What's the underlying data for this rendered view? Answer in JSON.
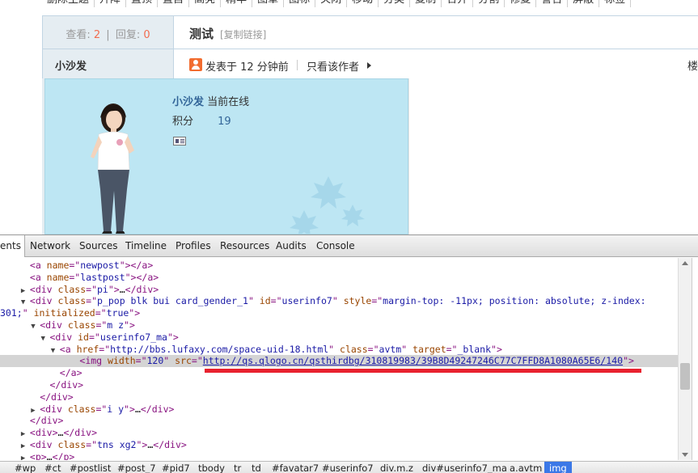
{
  "topnav": {
    "items": [
      "删除主题",
      "升降",
      "置顶",
      "置自",
      "高亮",
      "精华",
      "图章",
      "图标",
      "关闭",
      "移动",
      "分类",
      "复制",
      "合并",
      "分割",
      "修复",
      "警告",
      "屏蔽",
      "标签"
    ]
  },
  "thread": {
    "views_label": "查看:",
    "views": "2",
    "replies_label": "回复:",
    "replies": "0",
    "sep": "|",
    "title": "测试",
    "copy_link": "[复制链接]"
  },
  "post": {
    "author": "小沙发",
    "posted_at": "发表于 12 分钟前",
    "only_author": "只看该作者",
    "floor": "楼"
  },
  "card": {
    "username": "小沙发",
    "online": "当前在线",
    "points_label": "积分",
    "points": "19"
  },
  "devtools": {
    "tabs": [
      "ents",
      "Network",
      "Sources",
      "Timeline",
      "Profiles",
      "Resources",
      "Audits",
      "Console"
    ],
    "selected_url": "http://qs.qlogo.cn/qsthirdbg/310819983/39B8D49247246C77C7FFD8A1080A65E6/140",
    "breadcrumbs": [
      "#wp",
      "#ct",
      "#postlist",
      "#post_7",
      "#pid7",
      "tbody",
      "tr",
      "td",
      "#favatar7",
      "#userinfo7",
      "div.m.z",
      "div#userinfo7_ma",
      "a.avtm",
      "img"
    ],
    "rows": [
      {
        "indent": 3,
        "arrow": "",
        "parts": [
          [
            "tag",
            "<a "
          ],
          [
            "an",
            "name"
          ],
          [
            "tag",
            "=\""
          ],
          [
            "av",
            "newpost"
          ],
          [
            "tag",
            "\"></a>"
          ]
        ]
      },
      {
        "indent": 3,
        "arrow": "",
        "parts": [
          [
            "tag",
            "<a "
          ],
          [
            "an",
            "name"
          ],
          [
            "tag",
            "=\""
          ],
          [
            "av",
            "lastpost"
          ],
          [
            "tag",
            "\"></a>"
          ]
        ]
      },
      {
        "indent": 3,
        "arrow": "▶",
        "parts": [
          [
            "tag",
            "<div "
          ],
          [
            "an",
            "class"
          ],
          [
            "tag",
            "=\""
          ],
          [
            "av",
            "pi"
          ],
          [
            "tag",
            "\">"
          ],
          [
            "txt",
            "…"
          ],
          [
            "tag",
            "</div>"
          ]
        ]
      },
      {
        "indent": 3,
        "arrow": "▼",
        "parts": [
          [
            "tag",
            "<div "
          ],
          [
            "an",
            "class"
          ],
          [
            "tag",
            "=\""
          ],
          [
            "av",
            "p_pop blk bui card_gender_1"
          ],
          [
            "tag",
            "\" "
          ],
          [
            "an",
            "id"
          ],
          [
            "tag",
            "=\""
          ],
          [
            "av",
            "userinfo7"
          ],
          [
            "tag",
            "\" "
          ],
          [
            "an",
            "style"
          ],
          [
            "tag",
            "=\""
          ],
          [
            "av",
            "margin-top: -11px; position: absolute; z-index:"
          ]
        ]
      },
      {
        "indent": 0,
        "arrow": "",
        "parts": [
          [
            "av",
            "301;"
          ],
          [
            "tag",
            "\" "
          ],
          [
            "an",
            "initialized"
          ],
          [
            "tag",
            "=\""
          ],
          [
            "av",
            "true"
          ],
          [
            "tag",
            "\">"
          ]
        ]
      },
      {
        "indent": 4,
        "arrow": "▼",
        "parts": [
          [
            "tag",
            "<div "
          ],
          [
            "an",
            "class"
          ],
          [
            "tag",
            "=\""
          ],
          [
            "av",
            "m z"
          ],
          [
            "tag",
            "\">"
          ]
        ]
      },
      {
        "indent": 5,
        "arrow": "▼",
        "parts": [
          [
            "tag",
            "<div "
          ],
          [
            "an",
            "id"
          ],
          [
            "tag",
            "=\""
          ],
          [
            "av",
            "userinfo7_ma"
          ],
          [
            "tag",
            "\">"
          ]
        ]
      },
      {
        "indent": 6,
        "arrow": "▼",
        "parts": [
          [
            "tag",
            "<a "
          ],
          [
            "an",
            "href"
          ],
          [
            "tag",
            "=\""
          ],
          [
            "av",
            "http://bbs.lufaxy.com/space-uid-18.html"
          ],
          [
            "tag",
            "\" "
          ],
          [
            "an",
            "class"
          ],
          [
            "tag",
            "=\""
          ],
          [
            "av",
            "avtm"
          ],
          [
            "tag",
            "\" "
          ],
          [
            "an",
            "target"
          ],
          [
            "tag",
            "=\""
          ],
          [
            "av",
            "_blank"
          ],
          [
            "tag",
            "\">"
          ]
        ]
      },
      {
        "indent": 8,
        "arrow": "",
        "sel": true,
        "parts": [
          [
            "tag",
            "<img "
          ],
          [
            "an",
            "width"
          ],
          [
            "tag",
            "=\""
          ],
          [
            "av",
            "120"
          ],
          [
            "tag",
            "\" "
          ],
          [
            "an",
            "src"
          ],
          [
            "tag",
            "=\""
          ],
          [
            "url",
            "http://qs.qlogo.cn/qsthirdbg/310819983/39B8D49247246C77C7FFD8A1080A65E6/140"
          ],
          [
            "tag",
            "\">"
          ]
        ]
      },
      {
        "indent": 6,
        "arrow": "",
        "parts": [
          [
            "tag",
            "</a>"
          ]
        ]
      },
      {
        "indent": 5,
        "arrow": "",
        "parts": [
          [
            "tag",
            "</div>"
          ]
        ]
      },
      {
        "indent": 4,
        "arrow": "",
        "parts": [
          [
            "tag",
            "</div>"
          ]
        ]
      },
      {
        "indent": 4,
        "arrow": "▶",
        "parts": [
          [
            "tag",
            "<div "
          ],
          [
            "an",
            "class"
          ],
          [
            "tag",
            "=\""
          ],
          [
            "av",
            "i y"
          ],
          [
            "tag",
            "\">"
          ],
          [
            "txt",
            "…"
          ],
          [
            "tag",
            "</div>"
          ]
        ]
      },
      {
        "indent": 3,
        "arrow": "",
        "parts": [
          [
            "tag",
            "</div>"
          ]
        ]
      },
      {
        "indent": 3,
        "arrow": "▶",
        "parts": [
          [
            "tag",
            "<div>"
          ],
          [
            "txt",
            "…"
          ],
          [
            "tag",
            "</div>"
          ]
        ]
      },
      {
        "indent": 3,
        "arrow": "▶",
        "parts": [
          [
            "tag",
            "<div "
          ],
          [
            "an",
            "class"
          ],
          [
            "tag",
            "=\""
          ],
          [
            "av",
            "tns xg2"
          ],
          [
            "tag",
            "\">"
          ],
          [
            "txt",
            "…"
          ],
          [
            "tag",
            "</div>"
          ]
        ]
      },
      {
        "indent": 3,
        "arrow": "▶",
        "parts": [
          [
            "tag",
            "<p>"
          ],
          [
            "txt",
            "…"
          ],
          [
            "tag",
            "</p>"
          ]
        ]
      }
    ]
  }
}
